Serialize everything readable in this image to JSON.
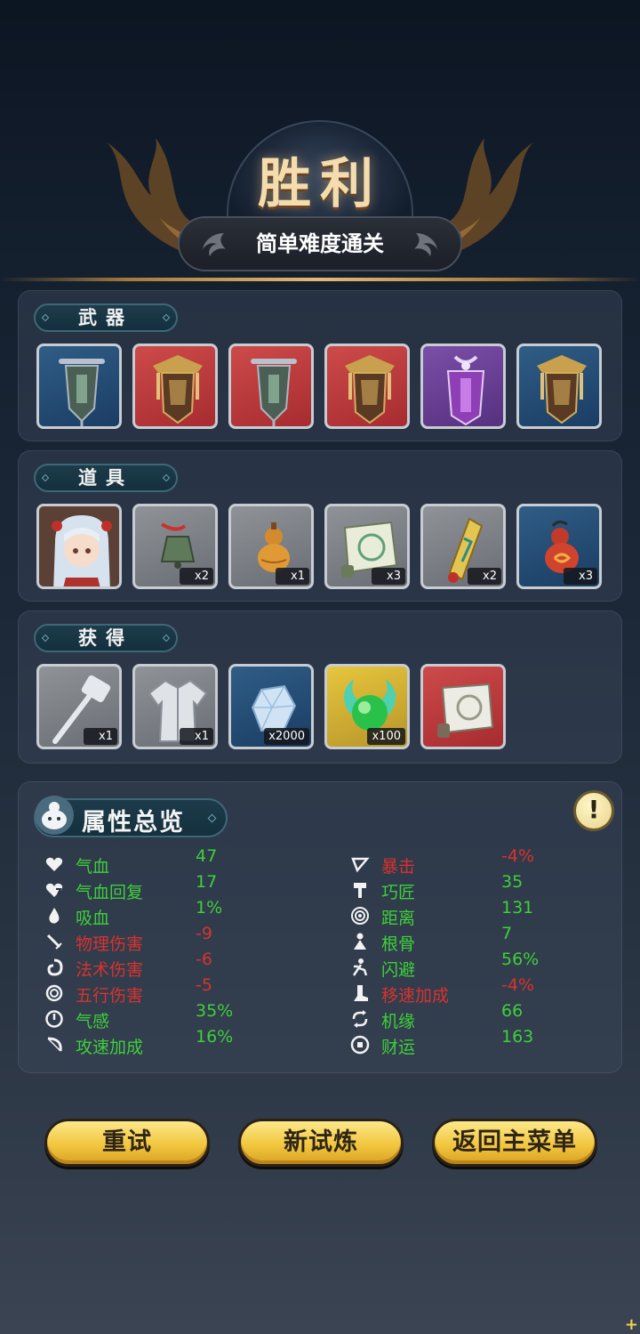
{
  "header": {
    "title": "胜利",
    "subtitle": "简单难度通关"
  },
  "weapons": {
    "label": "武器",
    "items": [
      {
        "icon": "banner-icon",
        "bg": "blue"
      },
      {
        "icon": "ornate-banner-icon",
        "bg": "red"
      },
      {
        "icon": "banner-icon",
        "bg": "red"
      },
      {
        "icon": "ornate-banner-icon",
        "bg": "red"
      },
      {
        "icon": "purple-banner-icon",
        "bg": "purple"
      },
      {
        "icon": "ornate-banner-icon",
        "bg": "blue"
      }
    ]
  },
  "props": {
    "label": "道具",
    "items": [
      {
        "icon": "character-portrait",
        "bg": "gray",
        "qty": ""
      },
      {
        "icon": "bell-icon",
        "bg": "gray",
        "qty": "x2"
      },
      {
        "icon": "gourd-icon",
        "bg": "gray",
        "qty": "x1"
      },
      {
        "icon": "scroll-icon",
        "bg": "gray",
        "qty": "x3"
      },
      {
        "icon": "talisman-icon",
        "bg": "gray",
        "qty": "x2"
      },
      {
        "icon": "red-gourd-icon",
        "bg": "blue",
        "qty": "x3"
      }
    ]
  },
  "rewards": {
    "label": "获得",
    "items": [
      {
        "icon": "hammer-icon",
        "bg": "gray",
        "qty": "x1"
      },
      {
        "icon": "robe-icon",
        "bg": "gray",
        "qty": "x1"
      },
      {
        "icon": "crystal-icon",
        "bg": "blue",
        "qty": "x2000"
      },
      {
        "icon": "jade-orb-icon",
        "bg": "gold",
        "qty": "x100"
      },
      {
        "icon": "scroll-icon",
        "bg": "red",
        "qty": ""
      }
    ]
  },
  "attributes": {
    "label": "属性总览",
    "info_icon": "exclamation-icon",
    "left": [
      {
        "icon": "heart-icon",
        "name": "气血",
        "value": "47",
        "tone": "pos"
      },
      {
        "icon": "heart-regen-icon",
        "name": "气血回复",
        "value": "17",
        "tone": "pos"
      },
      {
        "icon": "drop-icon",
        "name": "吸血",
        "value": "1%",
        "tone": "pos"
      },
      {
        "icon": "sword-icon",
        "name": "物理伤害",
        "value": "-9",
        "tone": "neg"
      },
      {
        "icon": "swirl-icon",
        "name": "法术伤害",
        "value": "-6",
        "tone": "neg"
      },
      {
        "icon": "spiral-icon",
        "name": "五行伤害",
        "value": "-5",
        "tone": "neg"
      },
      {
        "icon": "power-icon",
        "name": "气感",
        "value": "35%",
        "tone": "pos"
      },
      {
        "icon": "bow-icon",
        "name": "攻速加成",
        "value": "16%",
        "tone": "pos"
      }
    ],
    "right": [
      {
        "icon": "crit-icon",
        "name": "暴击",
        "value": "-4%",
        "tone": "neg"
      },
      {
        "icon": "hammer-small-icon",
        "name": "巧匠",
        "value": "35",
        "tone": "pos"
      },
      {
        "icon": "target-icon",
        "name": "距离",
        "value": "131",
        "tone": "pos"
      },
      {
        "icon": "figure-icon",
        "name": "根骨",
        "value": "7",
        "tone": "pos"
      },
      {
        "icon": "dodge-icon",
        "name": "闪避",
        "value": "56%",
        "tone": "pos"
      },
      {
        "icon": "boot-icon",
        "name": "移速加成",
        "value": "-4%",
        "tone": "neg"
      },
      {
        "icon": "cycle-icon",
        "name": "机缘",
        "value": "66",
        "tone": "pos"
      },
      {
        "icon": "coin-icon",
        "name": "财运",
        "value": "163",
        "tone": "pos"
      }
    ]
  },
  "buttons": {
    "retry": "重试",
    "new_trial": "新试炼",
    "main_menu": "返回主菜单"
  },
  "colors": {
    "positive": "#3fcf3a",
    "negative": "#d8332e",
    "button_gold": "#f2c73f"
  }
}
